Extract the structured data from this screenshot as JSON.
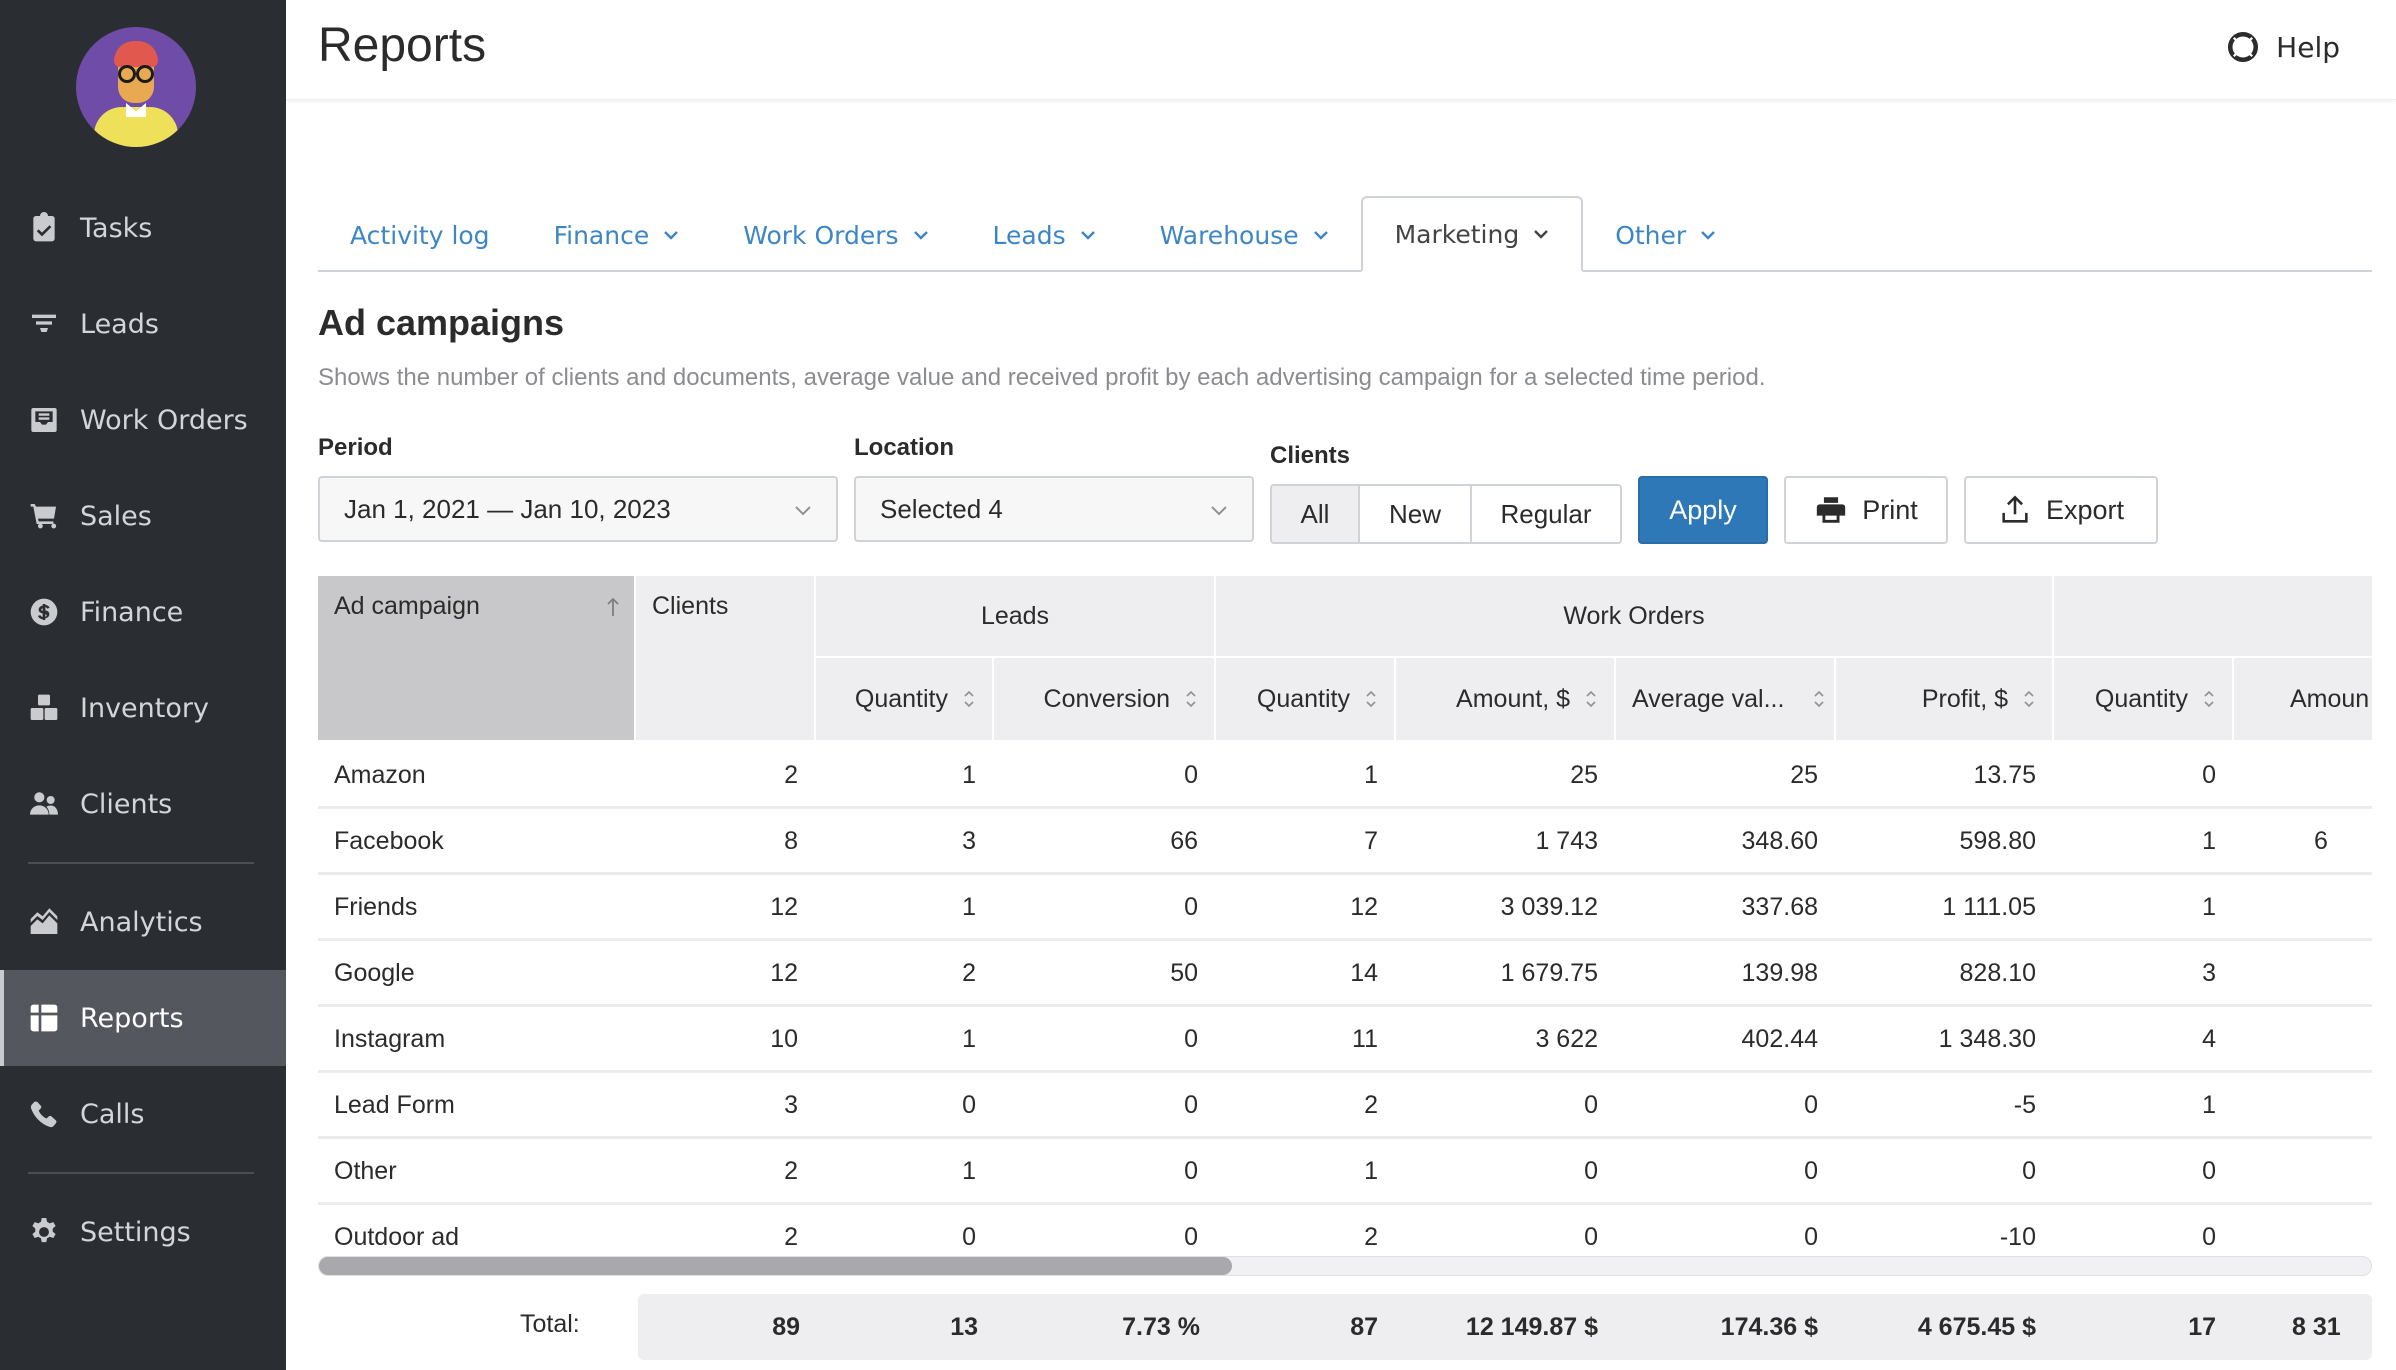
{
  "sidebar": {
    "avatar_alt": "User avatar",
    "items": [
      {
        "id": "tasks",
        "label": "Tasks",
        "icon": "clipboard-check-icon",
        "active": false
      },
      {
        "id": "leads",
        "label": "Leads",
        "icon": "funnel-icon",
        "active": false
      },
      {
        "id": "work-orders",
        "label": "Work Orders",
        "icon": "inbox-tray-icon",
        "active": false
      },
      {
        "id": "sales",
        "label": "Sales",
        "icon": "shopping-cart-icon",
        "active": false
      },
      {
        "id": "finance",
        "label": "Finance",
        "icon": "dollar-circle-icon",
        "active": false
      },
      {
        "id": "inventory",
        "label": "Inventory",
        "icon": "boxes-icon",
        "active": false
      },
      {
        "id": "clients",
        "label": "Clients",
        "icon": "users-icon",
        "active": false
      },
      {
        "id": "analytics",
        "label": "Analytics",
        "icon": "area-chart-icon",
        "active": false
      },
      {
        "id": "reports",
        "label": "Reports",
        "icon": "table-icon",
        "active": true
      },
      {
        "id": "calls",
        "label": "Calls",
        "icon": "phone-icon",
        "active": false
      },
      {
        "id": "settings",
        "label": "Settings",
        "icon": "gear-icon",
        "active": false
      }
    ]
  },
  "header": {
    "title": "Reports",
    "help_label": "Help"
  },
  "tabs": [
    {
      "label": "Activity log",
      "dropdown": false,
      "active": false
    },
    {
      "label": "Finance",
      "dropdown": true,
      "active": false
    },
    {
      "label": "Work Orders",
      "dropdown": true,
      "active": false
    },
    {
      "label": "Leads",
      "dropdown": true,
      "active": false
    },
    {
      "label": "Warehouse",
      "dropdown": true,
      "active": false
    },
    {
      "label": "Marketing",
      "dropdown": true,
      "active": true
    },
    {
      "label": "Other",
      "dropdown": true,
      "active": false
    }
  ],
  "section": {
    "title": "Ad campaigns",
    "description": "Shows the number of clients and documents, average value and received profit by each advertising campaign for a selected time period."
  },
  "filters": {
    "period_label": "Period",
    "period_value": "Jan 1, 2021 — Jan 10, 2023",
    "location_label": "Location",
    "location_value": "Selected 4",
    "clients_label": "Clients",
    "clients_options": [
      "All",
      "New",
      "Regular"
    ],
    "clients_selected": "All",
    "apply_label": "Apply",
    "print_label": "Print",
    "export_label": "Export"
  },
  "table": {
    "group_headers": {
      "ad_campaign": "Ad campaign",
      "clients": "Clients",
      "leads": "Leads",
      "work_orders": "Work Orders",
      "next_group": ""
    },
    "sub_headers": [
      "Quantity",
      "Conversion",
      "Quantity",
      "Amount, $",
      "Average val...",
      "Profit, $",
      "Quantity",
      "Amoun"
    ],
    "sort": {
      "column": "Ad campaign",
      "direction": "ascending"
    },
    "rows": [
      {
        "campaign": "Amazon",
        "clients": "2",
        "leads_qty": "1",
        "leads_conv": "0",
        "wo_qty": "1",
        "wo_amount": "25",
        "wo_avg": "25",
        "wo_profit": "13.75",
        "next_qty": "0",
        "next_amount": ""
      },
      {
        "campaign": "Facebook",
        "clients": "8",
        "leads_qty": "3",
        "leads_conv": "66",
        "wo_qty": "7",
        "wo_amount": "1 743",
        "wo_avg": "348.60",
        "wo_profit": "598.80",
        "next_qty": "1",
        "next_amount": "6"
      },
      {
        "campaign": "Friends",
        "clients": "12",
        "leads_qty": "1",
        "leads_conv": "0",
        "wo_qty": "12",
        "wo_amount": "3 039.12",
        "wo_avg": "337.68",
        "wo_profit": "1 111.05",
        "next_qty": "1",
        "next_amount": ""
      },
      {
        "campaign": "Google",
        "clients": "12",
        "leads_qty": "2",
        "leads_conv": "50",
        "wo_qty": "14",
        "wo_amount": "1 679.75",
        "wo_avg": "139.98",
        "wo_profit": "828.10",
        "next_qty": "3",
        "next_amount": ""
      },
      {
        "campaign": "Instagram",
        "clients": "10",
        "leads_qty": "1",
        "leads_conv": "0",
        "wo_qty": "11",
        "wo_amount": "3 622",
        "wo_avg": "402.44",
        "wo_profit": "1 348.30",
        "next_qty": "4",
        "next_amount": ""
      },
      {
        "campaign": "Lead Form",
        "clients": "3",
        "leads_qty": "0",
        "leads_conv": "0",
        "wo_qty": "2",
        "wo_amount": "0",
        "wo_avg": "0",
        "wo_profit": "-5",
        "next_qty": "1",
        "next_amount": ""
      },
      {
        "campaign": "Other",
        "clients": "2",
        "leads_qty": "1",
        "leads_conv": "0",
        "wo_qty": "1",
        "wo_amount": "0",
        "wo_avg": "0",
        "wo_profit": "0",
        "next_qty": "0",
        "next_amount": ""
      },
      {
        "campaign": "Outdoor ad",
        "clients": "2",
        "leads_qty": "0",
        "leads_conv": "0",
        "wo_qty": "2",
        "wo_amount": "0",
        "wo_avg": "0",
        "wo_profit": "-10",
        "next_qty": "0",
        "next_amount": ""
      }
    ],
    "scroll_position_fraction": 0.0,
    "scroll_visible_fraction": 0.445,
    "totals": {
      "label": "Total:",
      "clients": "89",
      "leads_qty": "13",
      "leads_conv": "7.73 %",
      "wo_qty": "87",
      "wo_amount": "12 149.87 $",
      "wo_avg": "174.36 $",
      "wo_profit": "4 675.45 $",
      "next_qty": "17",
      "next_amount": "8 31"
    }
  },
  "colors": {
    "sidebar_bg": "#2a2d32",
    "sidebar_active": "#54575d",
    "accent": "#2f78b8",
    "link": "#3d86c6",
    "header_cell_bg": "#eeedf0",
    "sorted_header_bg": "#c8c8ca"
  }
}
